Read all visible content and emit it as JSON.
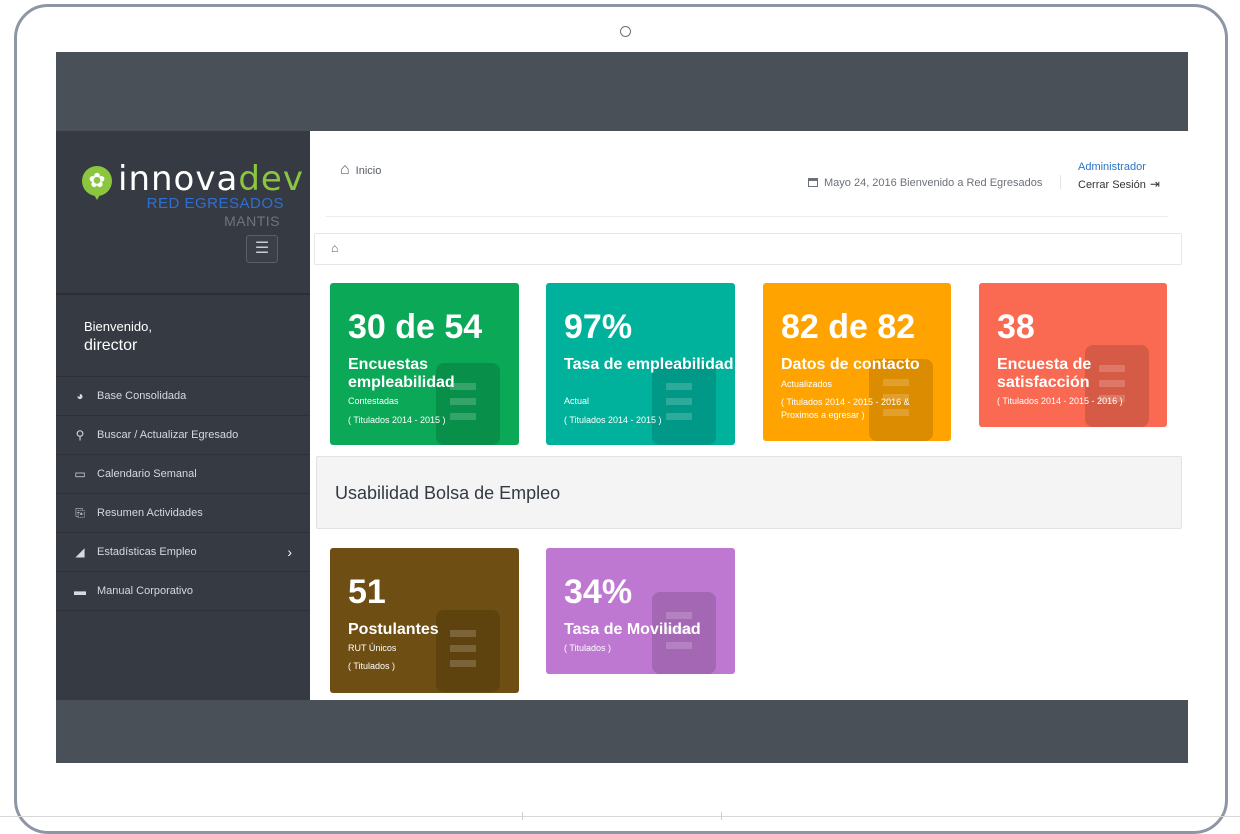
{
  "sidebar": {
    "logo": {
      "part1": "innova",
      "part2": "dev",
      "subtitle": "RED EGRESADOS",
      "subtitle2": "MANTIS"
    },
    "welcome": {
      "greeting": "Bienvenido,",
      "user": "director"
    },
    "items": [
      {
        "label": "Base Consolidada",
        "icon": "pie-chart-icon"
      },
      {
        "label": "Buscar / Actualizar Egresado",
        "icon": "search-icon"
      },
      {
        "label": "Calendario Semanal",
        "icon": "calendar-icon"
      },
      {
        "label": "Resumen Actividades",
        "icon": "clipboard-icon"
      },
      {
        "label": "Estadísticas Empleo",
        "icon": "area-chart-icon"
      },
      {
        "label": "Manual Corporativo",
        "icon": "folder-icon"
      }
    ]
  },
  "header": {
    "breadcrumb": "Inicio",
    "date_text": "Mayo 24, 2016 Bienvenido a Red Egresados",
    "admin_label": "Administrador",
    "logout_label": "Cerrar Sesión"
  },
  "tiles": [
    {
      "value": "30 de 54",
      "title": "Encuestas empleabilidad",
      "sub1": "Contestadas",
      "sub2": "( Titulados 2014 - 2015 )",
      "color": "#0aa857"
    },
    {
      "value": "97%",
      "title": "Tasa de empleabilidad",
      "sub1": "Actual",
      "sub2": "( Titulados 2014 - 2015 )",
      "color": "#00b29c"
    },
    {
      "value": "82 de 82",
      "title": "Datos de contacto",
      "sub1": "Actualizados",
      "sub2": "( Titulados 2014 - 2015 - 2016 & Proximos a egresar )",
      "color": "#ffa300"
    },
    {
      "value": "38",
      "title": "Encuesta de satisfacción",
      "sub1": "",
      "sub2": "( Titulados 2014 - 2015 - 2016 )",
      "color": "#fa6a52"
    }
  ],
  "section_title": "Usabilidad Bolsa de Empleo",
  "tiles2": [
    {
      "value": "51",
      "title": "Postulantes",
      "sub1": "RUT Únicos",
      "sub2": "( Titulados )",
      "color": "#6e4e12"
    },
    {
      "value": "34%",
      "title": "Tasa de Movilidad",
      "sub1": "",
      "sub2": "( Titulados )",
      "color": "#bf78d1"
    }
  ]
}
